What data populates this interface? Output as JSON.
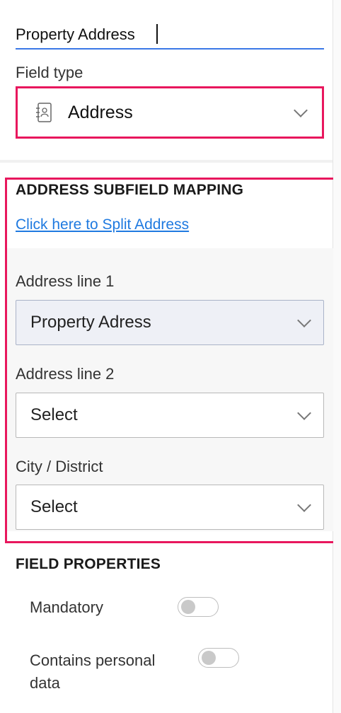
{
  "field": {
    "name_value": "Property Address",
    "type_label": "Field type",
    "type_value": "Address",
    "type_icon": "address-book-icon"
  },
  "mapping": {
    "section_title": "ADDRESS SUBFIELD MAPPING",
    "split_link": "Click here to Split Address",
    "line1_label": "Address line 1",
    "line1_value": "Property Adress",
    "line2_label": "Address line 2",
    "line2_value": "Select",
    "city_label": "City / District",
    "city_value": "Select"
  },
  "properties": {
    "section_title": "FIELD PROPERTIES",
    "mandatory_label": "Mandatory",
    "personal_label_line1": "Contains personal",
    "personal_label_line2": "data"
  },
  "colors": {
    "highlight": "#e8175d",
    "link": "#1f7ae0",
    "input_underline": "#3b78e7"
  }
}
